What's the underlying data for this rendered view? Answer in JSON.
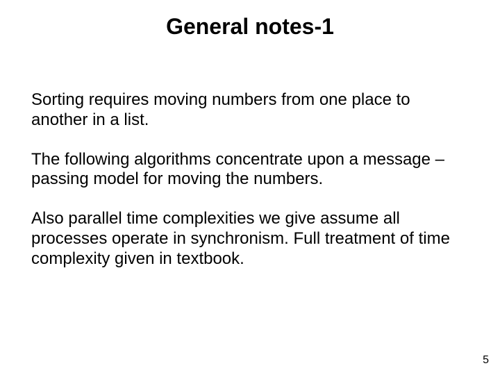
{
  "title": "General notes-1",
  "paragraphs": [
    "Sorting requires moving numbers from one place to another in a list.",
    "The following algorithms concentrate upon a message –passing model for moving the numbers.",
    "Also parallel time complexities we give assume all processes operate in synchronism. Full treatment of time complexity given in textbook."
  ],
  "page_number": "5"
}
